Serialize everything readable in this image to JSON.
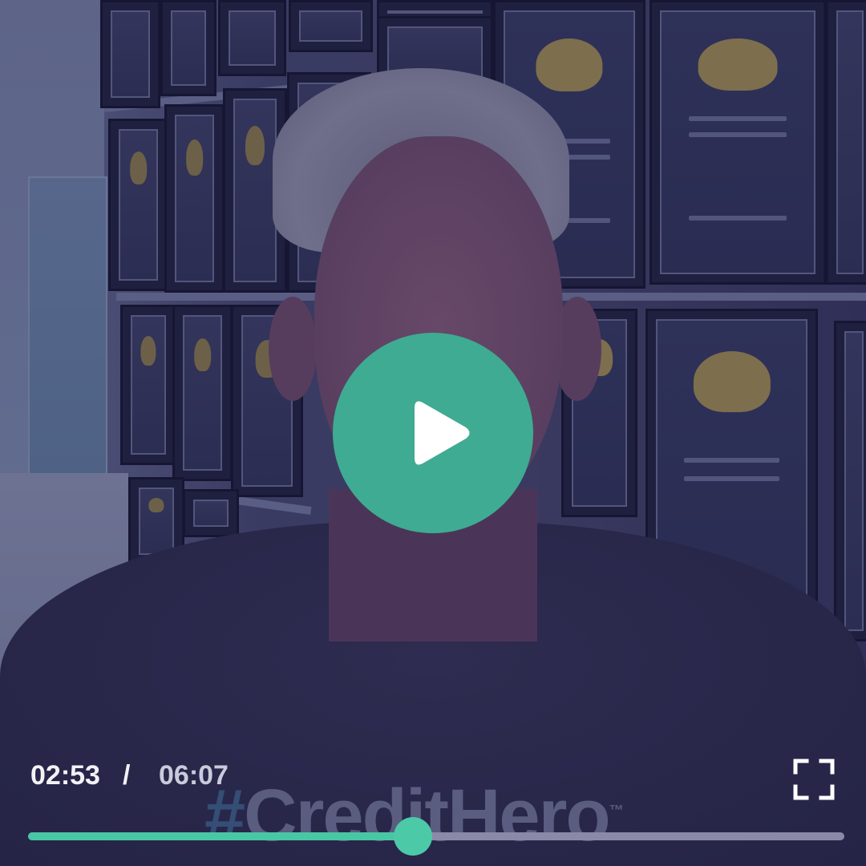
{
  "player": {
    "current_time": "02:53",
    "separator": "/",
    "total_time": "06:07",
    "progress": 0.4714,
    "accent_color": "#49c6a4",
    "play_button_color": "#3fab92",
    "play_icon": "play-icon",
    "fullscreen_icon": "fullscreen-icon"
  },
  "video_frame": {
    "shirt_text_hash": "#",
    "shirt_text_word": "CreditHero",
    "shirt_trademark": "™"
  }
}
